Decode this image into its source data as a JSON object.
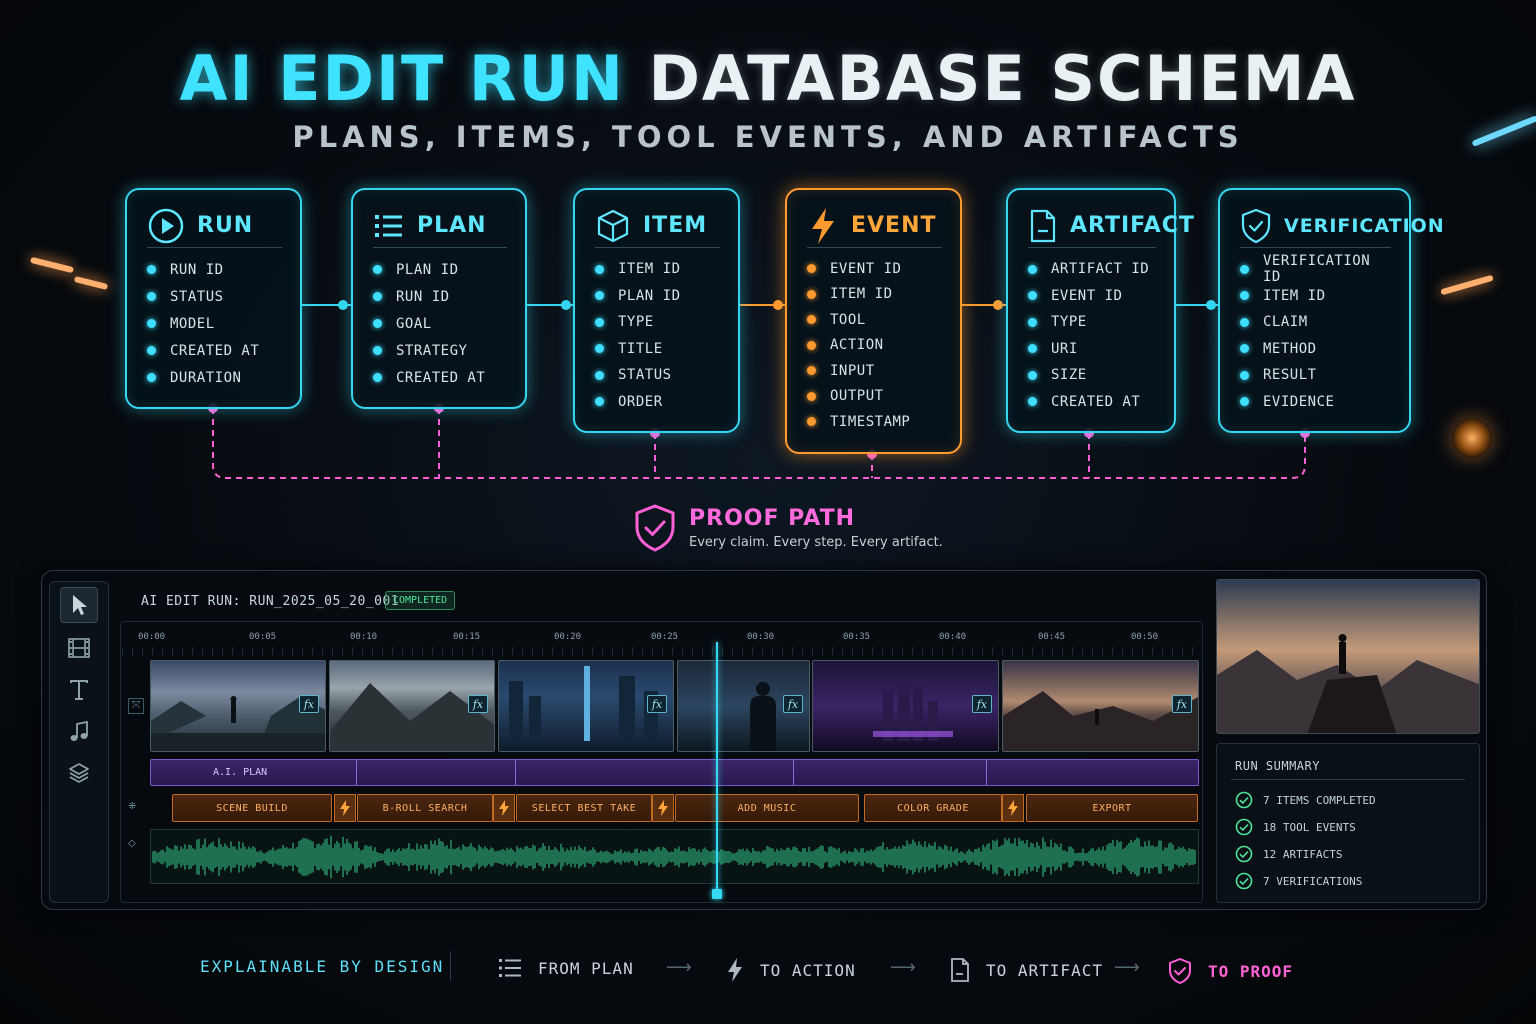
{
  "header": {
    "title_accent": "AI EDIT RUN",
    "title_rest": "DATABASE SCHEMA",
    "subtitle": "PLANS, ITEMS, TOOL EVENTS, AND ARTIFACTS"
  },
  "entities": [
    {
      "name": "RUN",
      "icon": "play-circle-icon",
      "fields": [
        "RUN ID",
        "STATUS",
        "MODEL",
        "CREATED AT",
        "DURATION"
      ]
    },
    {
      "name": "PLAN",
      "icon": "list-icon",
      "fields": [
        "PLAN ID",
        "RUN ID",
        "GOAL",
        "STRATEGY",
        "CREATED AT"
      ]
    },
    {
      "name": "ITEM",
      "icon": "cube-icon",
      "fields": [
        "ITEM ID",
        "PLAN ID",
        "TYPE",
        "TITLE",
        "STATUS",
        "ORDER"
      ]
    },
    {
      "name": "EVENT",
      "icon": "lightning-icon",
      "fields": [
        "EVENT ID",
        "ITEM ID",
        "TOOL",
        "ACTION",
        "INPUT",
        "OUTPUT",
        "TIMESTAMP"
      ]
    },
    {
      "name": "ARTIFACT",
      "icon": "document-icon",
      "fields": [
        "ARTIFACT ID",
        "EVENT ID",
        "TYPE",
        "URI",
        "SIZE",
        "CREATED AT"
      ]
    },
    {
      "name": "VERIFICATION",
      "icon": "shield-check-icon",
      "fields": [
        "VERIFICATION ID",
        "ITEM ID",
        "CLAIM",
        "METHOD",
        "RESULT",
        "EVIDENCE"
      ]
    }
  ],
  "proof_path": {
    "title": "PROOF PATH",
    "subtitle": "Every claim. Every step. Every artifact."
  },
  "editor": {
    "run_label": "AI EDIT RUN: RUN_2025_05_20_001",
    "status_badge": "COMPLETED",
    "timecodes": [
      "00:00",
      "00:05",
      "00:10",
      "00:15",
      "00:20",
      "00:25",
      "00:30",
      "00:35",
      "00:40",
      "00:45",
      "00:50"
    ],
    "plan_track_label": "A.I. PLAN",
    "actions": [
      "SCENE BUILD",
      "B-ROLL SEARCH",
      "SELECT BEST TAKE",
      "ADD MUSIC",
      "COLOR GRADE",
      "EXPORT"
    ],
    "clip_badge": "fx",
    "tools": [
      "cursor-icon",
      "film-icon",
      "text-icon",
      "music-icon",
      "layers-icon"
    ]
  },
  "summary": {
    "title": "RUN SUMMARY",
    "items": [
      "7 ITEMS COMPLETED",
      "18 TOOL EVENTS",
      "12 ARTIFACTS",
      "7 VERIFICATIONS"
    ]
  },
  "footer": {
    "tagline": "EXPLAINABLE BY DESIGN",
    "steps": [
      "FROM PLAN",
      "TO ACTION",
      "TO ARTIFACT",
      "TO PROOF"
    ]
  },
  "colors": {
    "cyan": "#35d6f0",
    "orange": "#ff9a2e",
    "magenta": "#ff5fd6",
    "purple": "#7b58c9",
    "green": "#4fe39a"
  }
}
